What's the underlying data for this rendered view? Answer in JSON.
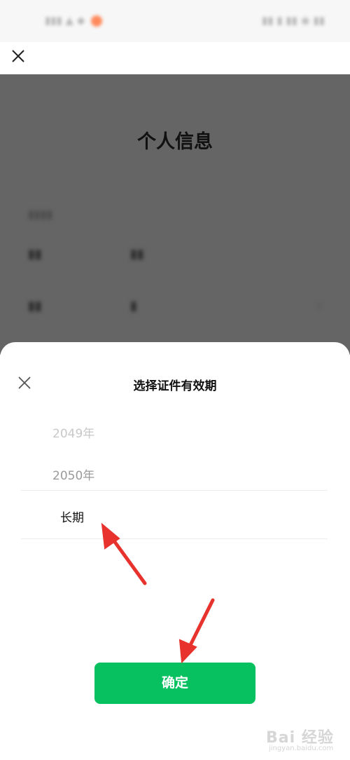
{
  "background_page": {
    "title": "个人信息"
  },
  "sheet": {
    "title": "选择证件有效期",
    "picker_options": [
      "2049年",
      "2050年",
      "长期"
    ],
    "selected_option": "长期",
    "confirm_label": "确定"
  },
  "colors": {
    "accent_green": "#07c160",
    "annotation_red": "#e8322d",
    "overlay": "#656565"
  },
  "watermark": {
    "text": "Bai 经验",
    "url": "jingyan.baidu.com"
  }
}
